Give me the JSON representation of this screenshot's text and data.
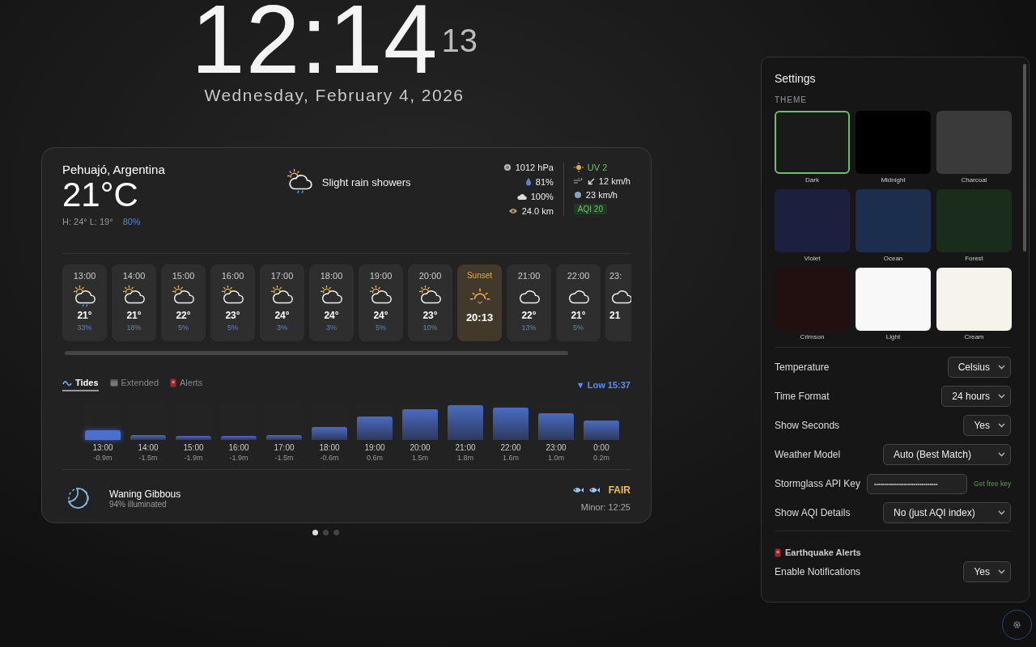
{
  "clock": {
    "time": "12:14",
    "seconds": "13",
    "date": "Wednesday, February 4, 2026"
  },
  "weather": {
    "location": "Pehuajó, Argentina",
    "temperature": "21°C",
    "high_low": "H: 24° L: 19°",
    "precipitation": "80%",
    "condition": "Slight rain showers",
    "stats_left": [
      {
        "kind": "pressure",
        "value": "1012 hPa"
      },
      {
        "kind": "humidity",
        "value": "81%"
      },
      {
        "kind": "cloud",
        "value": "100%"
      },
      {
        "kind": "visibility",
        "value": "24.0 km"
      }
    ],
    "uv": "UV 2",
    "wind": "12 km/h",
    "gust": "23 km/h",
    "aqi": "AQI 20"
  },
  "hourly": [
    {
      "kind": "sun-rain",
      "time": "13:00",
      "temp": "21°",
      "rain": "33%"
    },
    {
      "kind": "sun-cloud",
      "time": "14:00",
      "temp": "21°",
      "rain": "18%"
    },
    {
      "kind": "sun-cloud",
      "time": "15:00",
      "temp": "22°",
      "rain": "5%"
    },
    {
      "kind": "sun-cloud",
      "time": "16:00",
      "temp": "23°",
      "rain": "5%"
    },
    {
      "kind": "sun-cloud",
      "time": "17:00",
      "temp": "24°",
      "rain": "3%"
    },
    {
      "kind": "sun-cloud",
      "time": "18:00",
      "temp": "24°",
      "rain": "3%"
    },
    {
      "kind": "sun-cloud",
      "time": "19:00",
      "temp": "24°",
      "rain": "5%"
    },
    {
      "kind": "sun-cloud",
      "time": "20:00",
      "temp": "23°",
      "rain": "10%"
    },
    {
      "kind": "sunset",
      "time": "Sunset",
      "temp": "20:13"
    },
    {
      "kind": "moon-cloud",
      "time": "21:00",
      "temp": "22°",
      "rain": "13%"
    },
    {
      "kind": "moon-cloud",
      "time": "22:00",
      "temp": "21°",
      "rain": "5%"
    },
    {
      "kind": "moon-cloud",
      "time": "23:",
      "temp": "21"
    }
  ],
  "tabs": [
    {
      "kind": "tides",
      "label": "Tides",
      "selected": true
    },
    {
      "kind": "extended",
      "label": "Extended",
      "selected": false
    },
    {
      "kind": "alerts",
      "label": "Alerts",
      "selected": false
    }
  ],
  "next_tide": "▼ Low 15:37",
  "tides": [
    {
      "time": "13:00",
      "height": "-0.9m",
      "level": 0.27,
      "selected": true
    },
    {
      "time": "14:00",
      "height": "-1.5m",
      "level": 0.13,
      "selected": false
    },
    {
      "time": "15:00",
      "height": "-1.9m",
      "level": 0.1,
      "selected": false
    },
    {
      "time": "16:00",
      "height": "-1.9m",
      "level": 0.1,
      "selected": false
    },
    {
      "time": "17:00",
      "height": "-1.5m",
      "level": 0.13,
      "selected": false
    },
    {
      "time": "18:00",
      "height": "-0.6m",
      "level": 0.35,
      "selected": false
    },
    {
      "time": "19:00",
      "height": "0.6m",
      "level": 0.62,
      "selected": false
    },
    {
      "time": "20:00",
      "height": "1.5m",
      "level": 0.83,
      "selected": false
    },
    {
      "time": "21:00",
      "height": "1.8m",
      "level": 0.93,
      "selected": false
    },
    {
      "time": "22:00",
      "height": "1.6m",
      "level": 0.87,
      "selected": false
    },
    {
      "time": "23:00",
      "height": "1.0m",
      "level": 0.71,
      "selected": false
    },
    {
      "time": "0:00",
      "height": "0.2m",
      "level": 0.52,
      "selected": false
    }
  ],
  "moon": {
    "phase": "Waning Gibbous",
    "illumination": "94% illuminated"
  },
  "fishing": {
    "rating": "FAIR",
    "minor": "Minor: 12:25"
  },
  "pages": [
    {
      "selected": true
    },
    {
      "selected": false
    },
    {
      "selected": false
    }
  ],
  "settings": {
    "title": "Settings",
    "theme_heading": "THEME",
    "themes": [
      {
        "name": "Dark",
        "color": "#1a1a1a",
        "selected": true
      },
      {
        "name": "Midnight",
        "color": "#000000",
        "selected": false
      },
      {
        "name": "Charcoal",
        "color": "#3a3a3a",
        "selected": false
      },
      {
        "name": "Violet",
        "color": "#1c1f3d",
        "selected": false
      },
      {
        "name": "Ocean",
        "color": "#1b2e4d",
        "selected": false
      },
      {
        "name": "Forest",
        "color": "#1a2c1c",
        "selected": false
      },
      {
        "name": "Crimson",
        "color": "#221010",
        "selected": false
      },
      {
        "name": "Light",
        "color": "#f8f8f8",
        "selected": false
      },
      {
        "name": "Cream",
        "color": "#f6f2ec",
        "selected": false
      }
    ],
    "rows": [
      {
        "kind": "select",
        "label": "Temperature",
        "value": "Celsius"
      },
      {
        "kind": "select",
        "label": "Time Format",
        "value": "24 hours"
      },
      {
        "kind": "select",
        "label": "Show Seconds",
        "value": "Yes"
      },
      {
        "kind": "select",
        "label": "Weather Model",
        "value": "Auto (Best Match)"
      },
      {
        "kind": "input",
        "label": "Stormglass API Key",
        "value": "••••••••••••••••••••••••••••••••",
        "link": "Get free key"
      },
      {
        "kind": "select",
        "label": "Show AQI Details",
        "value": "No (just AQI index)"
      },
      {
        "kind": "section",
        "label": "Earthquake Alerts"
      },
      {
        "kind": "select",
        "label": "Enable Notifications",
        "value": "Yes"
      }
    ]
  }
}
